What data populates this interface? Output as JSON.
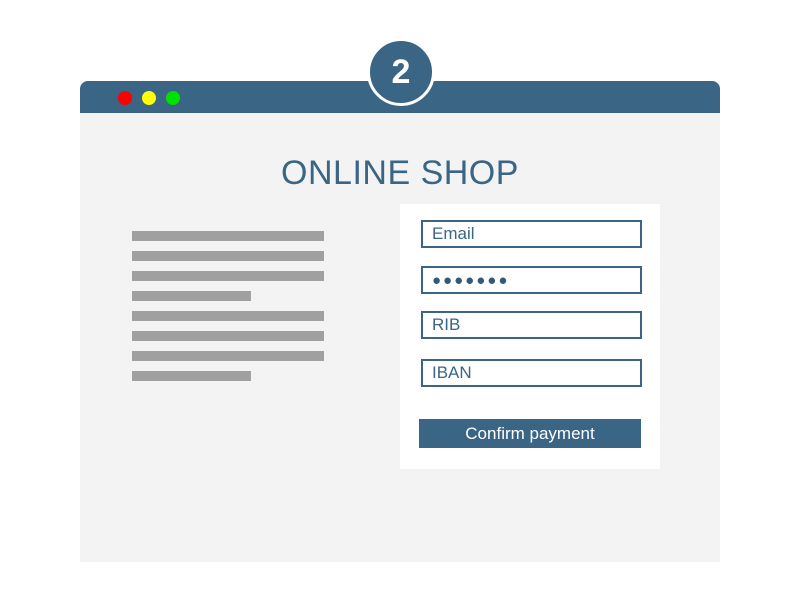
{
  "step": {
    "number": "2"
  },
  "window": {
    "title_bar_color": "#3a6585",
    "controls": [
      "close-dot",
      "minimize-dot",
      "maximize-dot"
    ],
    "control_colors": {
      "close": "#ff0000",
      "minimize": "#ffff00",
      "maximize": "#00e000"
    }
  },
  "page": {
    "title": "ONLINE SHOP"
  },
  "text_placeholder": {
    "line_count": 8,
    "line_color": "#a0a0a0"
  },
  "form": {
    "email": {
      "placeholder": "Email",
      "value": ""
    },
    "password": {
      "placeholder": "",
      "value": "●●●●●●●"
    },
    "rib": {
      "placeholder": "RIB",
      "value": ""
    },
    "iban": {
      "placeholder": "IBAN",
      "value": ""
    },
    "confirm_label": "Confirm payment"
  },
  "colors": {
    "accent": "#3a6585",
    "background": "#f3f3f3",
    "panel": "#ffffff"
  }
}
